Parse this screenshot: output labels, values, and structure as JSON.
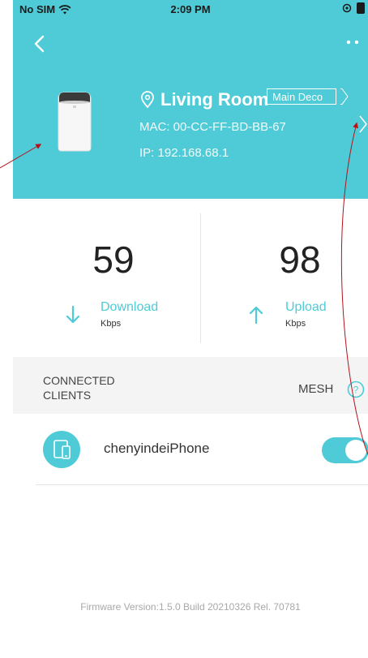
{
  "status_bar": {
    "carrier": "No SIM",
    "time": "2:09 PM"
  },
  "device": {
    "location": "Living Room",
    "badge": "Main Deco",
    "mac": "MAC: 00-CC-FF-BD-BB-67",
    "ip": "IP: 192.168.68.1"
  },
  "stats": {
    "download": {
      "value": "59",
      "label": "Download",
      "unit": "Kbps"
    },
    "upload": {
      "value": "98",
      "label": "Upload",
      "unit": "Kbps"
    }
  },
  "section": {
    "title": "CONNECTED CLIENTS",
    "mesh_label": "MESH"
  },
  "clients": [
    {
      "name": "chenyindeiPhone",
      "enabled": true
    }
  ],
  "firmware": "Firmware Version:1.5.0 Build 20210326 Rel. 70781",
  "colors": {
    "accent": "#4ecbd6",
    "annotation": "#b5121b"
  }
}
